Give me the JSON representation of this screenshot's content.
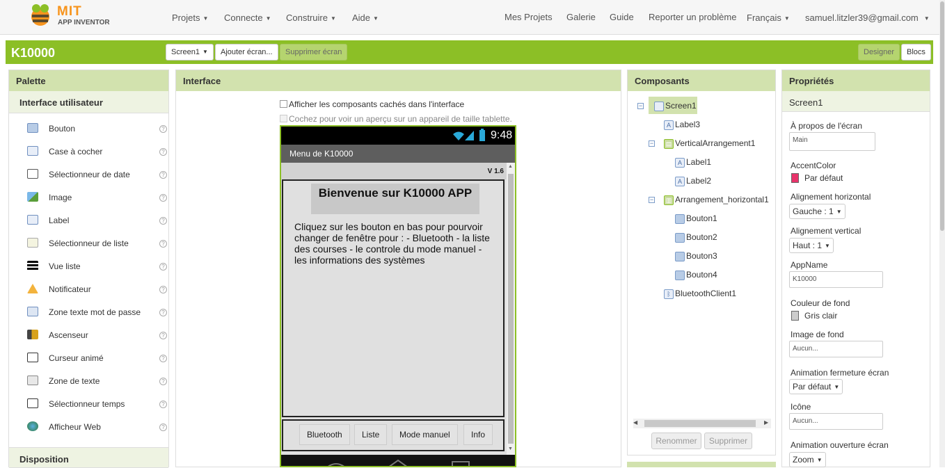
{
  "topbar": {
    "logo_mit": "MIT",
    "logo_sub": "APP INVENTOR",
    "menus": [
      "Projets",
      "Connecte",
      "Construire",
      "Aide"
    ],
    "links": [
      "Mes Projets",
      "Galerie",
      "Guide",
      "Reporter un problème"
    ],
    "language": "Français",
    "user": "samuel.litzler39@gmail.com"
  },
  "project": {
    "name": "K10000",
    "screen_select": "Screen1",
    "add_screen": "Ajouter écran...",
    "remove_screen": "Supprimer écran",
    "designer": "Designer",
    "blocks": "Blocs"
  },
  "palette": {
    "title": "Palette",
    "section": "Interface utilisateur",
    "items": [
      {
        "label": "Bouton",
        "icon": "button-icon"
      },
      {
        "label": "Case à cocher",
        "icon": "checkbox-icon"
      },
      {
        "label": "Sélectionneur de date",
        "icon": "calendar-icon"
      },
      {
        "label": "Image",
        "icon": "image-icon"
      },
      {
        "label": "Label",
        "icon": "label-icon"
      },
      {
        "label": "Sélectionneur de liste",
        "icon": "list-picker-icon"
      },
      {
        "label": "Vue liste",
        "icon": "list-view-icon"
      },
      {
        "label": "Notificateur",
        "icon": "warning-icon"
      },
      {
        "label": "Zone texte mot de passe",
        "icon": "password-icon"
      },
      {
        "label": "Ascenseur",
        "icon": "slider-icon"
      },
      {
        "label": "Curseur animé",
        "icon": "spinner-icon"
      },
      {
        "label": "Zone de texte",
        "icon": "textbox-icon"
      },
      {
        "label": "Sélectionneur temps",
        "icon": "time-picker-icon"
      },
      {
        "label": "Afficheur Web",
        "icon": "web-viewer-icon"
      }
    ],
    "next_section": "Disposition"
  },
  "viewer": {
    "title": "Interface",
    "show_hidden": "Afficher les composants cachés dans l'interface",
    "tablet_preview": "Cochez pour voir un aperçu sur un appareil de taille tablette.",
    "status_time": "9:48",
    "screen_title": "Menu de K10000",
    "version": "V 1.6",
    "welcome": "Bienvenue sur K10000 APP",
    "body_text": "Cliquez sur les bouton en bas pour pourvoir changer de fenêtre pour : - Bluetooth - la liste des courses - le controle du mode manuel - les informations des systèmes",
    "buttons": [
      "Bluetooth",
      "Liste",
      "Mode manuel",
      "Info"
    ]
  },
  "components": {
    "title": "Composants",
    "tree": [
      {
        "label": "Screen1"
      },
      {
        "label": "Label3"
      },
      {
        "label": "VerticalArrangement1"
      },
      {
        "label": "Label1"
      },
      {
        "label": "Label2"
      },
      {
        "label": "Arrangement_horizontal1"
      },
      {
        "label": "Bouton1"
      },
      {
        "label": "Bouton2"
      },
      {
        "label": "Bouton3"
      },
      {
        "label": "Bouton4"
      },
      {
        "label": "BluetoothClient1"
      }
    ],
    "rename": "Renommer",
    "delete": "Supprimer"
  },
  "properties": {
    "title": "Propriétés",
    "component": "Screen1",
    "about_label": "À propos de l'écran",
    "about_value": "Main",
    "accent_label": "AccentColor",
    "accent_value": "Par défaut",
    "accent_color": "#e8336b",
    "halign_label": "Alignement horizontal",
    "halign_value": "Gauche : 1",
    "valign_label": "Alignement vertical",
    "valign_value": "Haut : 1",
    "appname_label": "AppName",
    "appname_value": "K10000",
    "bgcolor_label": "Couleur de fond",
    "bgcolor_value": "Gris clair",
    "bgcolor_color": "#cccccc",
    "bgimage_label": "Image de fond",
    "bgimage_value": "Aucun...",
    "close_anim_label": "Animation fermeture écran",
    "close_anim_value": "Par défaut",
    "icon_label": "Icône",
    "icon_value": "Aucun...",
    "open_anim_label": "Animation ouverture écran",
    "open_anim_value": "Zoom"
  }
}
